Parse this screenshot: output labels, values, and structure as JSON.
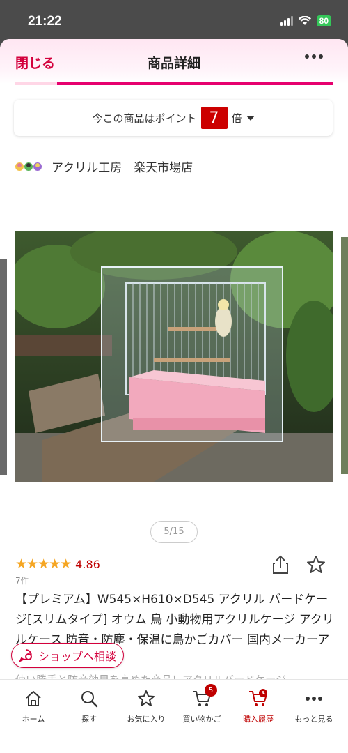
{
  "status": {
    "time": "21:22",
    "battery": "80"
  },
  "header": {
    "close_label": "閉じる",
    "title": "商品詳細"
  },
  "points": {
    "prefix": "今この商品はポイント",
    "multiplier": "7",
    "suffix": "倍"
  },
  "shop": {
    "name": "アクリル工房　楽天市場店"
  },
  "gallery": {
    "pager": "5/15"
  },
  "rating": {
    "stars": "★★★★★",
    "value": "4.86",
    "count": "7件"
  },
  "product": {
    "title": "【プレミアム】W545×H610×D545 アクリル バードケージ[スリムタイプ] オウム 鳥 小動物用アクリルケージ アクリルケース 防音・防塵・保温に鳥かごカバー 国内メーカーアクリル"
  },
  "consult": {
    "label": "ショップへ相談"
  },
  "description": {
    "text": "使い勝手と防音効果を高めた商品！アクリルバードケージ"
  },
  "tabbar": {
    "items": [
      {
        "label": "ホーム"
      },
      {
        "label": "探す"
      },
      {
        "label": "お気に入り"
      },
      {
        "label": "買い物かご",
        "badge": "5"
      },
      {
        "label": "購入履歴"
      },
      {
        "label": "もっと見る"
      }
    ]
  },
  "colors": {
    "accent": "#bf0000",
    "brand_pink": "#e6006e",
    "star": "#f5a623"
  }
}
